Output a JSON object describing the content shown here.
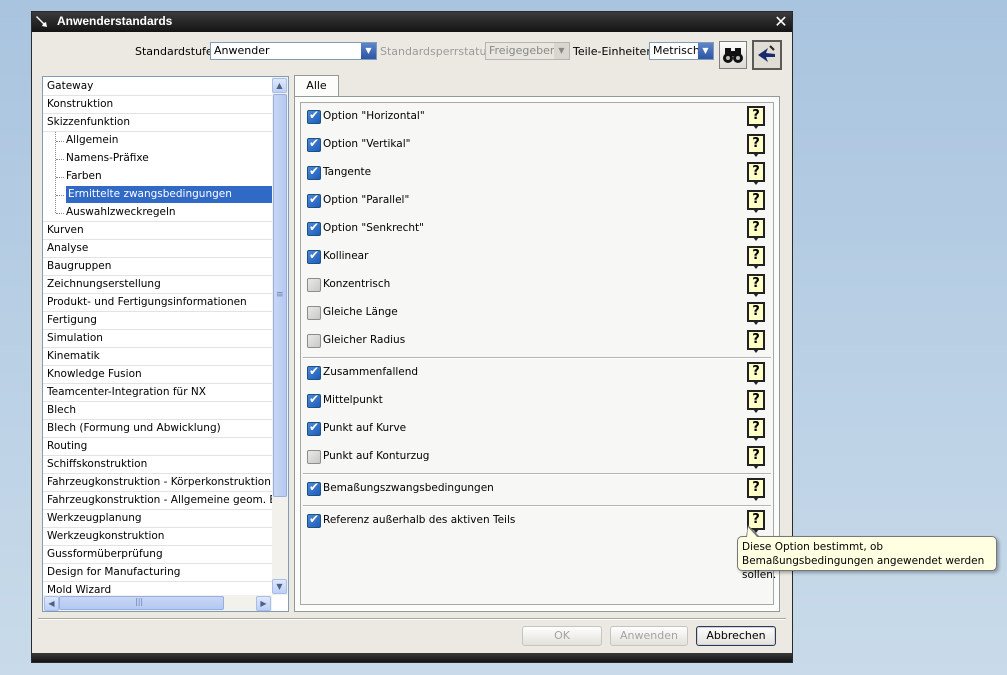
{
  "dialog": {
    "title": "Anwenderstandards",
    "close_label": "✕"
  },
  "topbar": {
    "standardstufe_label": "Standardstufe",
    "standardstufe_value": "Anwender",
    "sperrstatus_label": "Standardsperrstatus",
    "sperrstatus_value": "Freigegeben",
    "einheiten_label": "Teile-Einheiten",
    "einheiten_value": "Metrisch",
    "find_icon": "binoculars-icon",
    "pointer_icon": "pointer-icon"
  },
  "tree": {
    "items": [
      {
        "label": "Gateway",
        "level": 0
      },
      {
        "label": "Konstruktion",
        "level": 0
      },
      {
        "label": "Skizzenfunktion",
        "level": 0
      },
      {
        "label": "Allgemein",
        "level": 1
      },
      {
        "label": "Namens-Präfixe",
        "level": 1
      },
      {
        "label": "Farben",
        "level": 1
      },
      {
        "label": "Ermittelte zwangsbedingungen",
        "level": 1,
        "selected": true
      },
      {
        "label": "Auswahlzweckregeln",
        "level": 1
      },
      {
        "label": "Kurven",
        "level": 0
      },
      {
        "label": "Analyse",
        "level": 0
      },
      {
        "label": "Baugruppen",
        "level": 0
      },
      {
        "label": "Zeichnungserstellung",
        "level": 0
      },
      {
        "label": "Produkt- und Fertigungsinformationen",
        "level": 0
      },
      {
        "label": "Fertigung",
        "level": 0
      },
      {
        "label": "Simulation",
        "level": 0
      },
      {
        "label": "Kinematik",
        "level": 0
      },
      {
        "label": "Knowledge Fusion",
        "level": 0
      },
      {
        "label": "Teamcenter-Integration für NX",
        "level": 0
      },
      {
        "label": "Blech",
        "level": 0
      },
      {
        "label": "Blech (Formung und Abwicklung)",
        "level": 0
      },
      {
        "label": "Routing",
        "level": 0
      },
      {
        "label": "Schiffskonstruktion",
        "level": 0
      },
      {
        "label": "Fahrzeugkonstruktion - Körperkonstruktion",
        "level": 0
      },
      {
        "label": "Fahrzeugkonstruktion - Allgemeine geom. Bere",
        "level": 0
      },
      {
        "label": "Werkzeugplanung",
        "level": 0
      },
      {
        "label": "Werkzeugkonstruktion",
        "level": 0
      },
      {
        "label": "Gussformüberprüfung",
        "level": 0
      },
      {
        "label": "Design for Manufacturing",
        "level": 0
      },
      {
        "label": "Mold Wizard",
        "level": 0
      }
    ]
  },
  "tabs": [
    {
      "label": "Alle"
    }
  ],
  "options": {
    "group1": [
      {
        "label": "Option \"Horizontal\"",
        "checked": true
      },
      {
        "label": "Option \"Vertikal\"",
        "checked": true
      },
      {
        "label": "Tangente",
        "checked": true
      },
      {
        "label": "Option \"Parallel\"",
        "checked": true
      },
      {
        "label": "Option \"Senkrecht\"",
        "checked": true
      },
      {
        "label": "Kollinear",
        "checked": true
      },
      {
        "label": "Konzentrisch",
        "checked": false
      },
      {
        "label": "Gleiche Länge",
        "checked": false
      },
      {
        "label": "Gleicher Radius",
        "checked": false
      }
    ],
    "group2": [
      {
        "label": "Zusammenfallend",
        "checked": true
      },
      {
        "label": "Mittelpunkt",
        "checked": true
      },
      {
        "label": "Punkt auf Kurve",
        "checked": true
      },
      {
        "label": "Punkt auf Konturzug",
        "checked": false
      }
    ],
    "group3": [
      {
        "label": "Bemaßungszwangsbedingungen",
        "checked": true
      }
    ],
    "group4": [
      {
        "label": "Referenz außerhalb des aktiven Teils",
        "checked": true
      }
    ],
    "help_symbol": "?"
  },
  "tooltip": {
    "text": "Diese Option bestimmt, ob Bemaßungsbedingungen angewendet werden sollen."
  },
  "buttons": {
    "ok": "OK",
    "apply": "Anwenden",
    "cancel": "Abbrechen"
  },
  "scroll_icons": {
    "up": "▲",
    "down": "▼",
    "left": "◀",
    "right": "▶",
    "grip": "≡",
    "hgrip": "|||"
  }
}
